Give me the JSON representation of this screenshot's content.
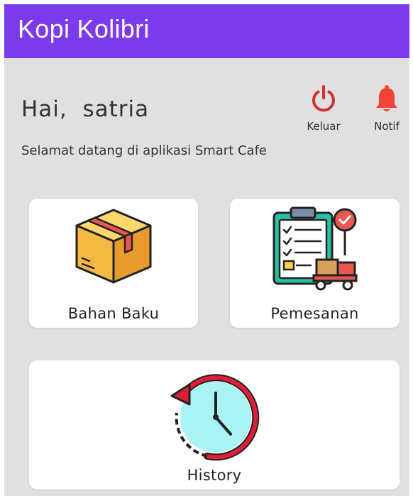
{
  "app": {
    "title": "Kopi Kolibri"
  },
  "header": {
    "greeting": "Hai,  satria",
    "welcome_text": "Selamat datang di aplikasi Smart Cafe"
  },
  "actions": {
    "logout_label": "Keluar",
    "logout_icon": "power-icon",
    "notif_label": "Notif",
    "notif_icon": "bell-icon"
  },
  "menu": [
    {
      "label": "Bahan Baku",
      "icon": "box-icon"
    },
    {
      "label": "Pemesanan",
      "icon": "clipboard-order-icon"
    },
    {
      "label": "History",
      "icon": "history-clock-icon"
    }
  ],
  "colors": {
    "appbar": "#7c3aed",
    "background": "#e0e0e0",
    "logout": "#d32f2f",
    "notif": "#f44336"
  }
}
